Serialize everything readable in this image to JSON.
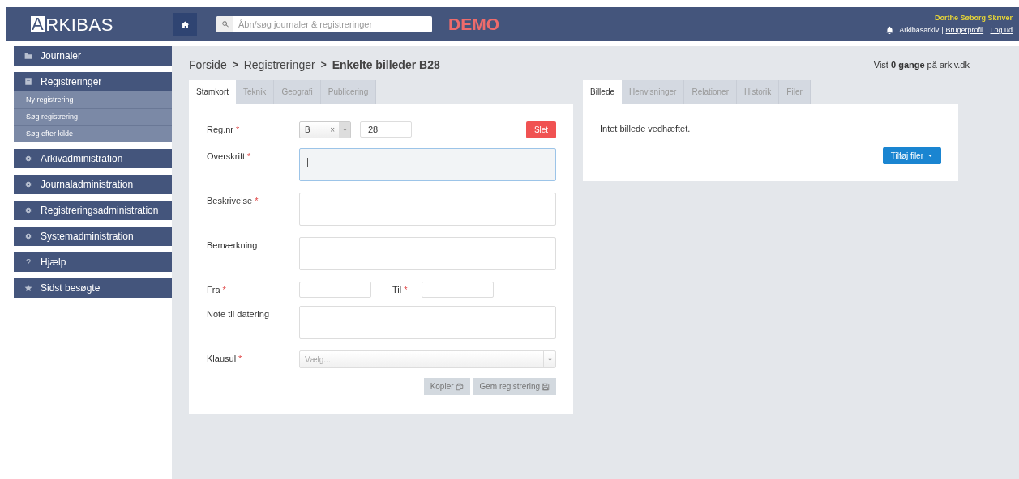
{
  "header": {
    "logo": "ARKIBAS",
    "search": {
      "placeholder": "Åbn/søg journaler & registreringer"
    },
    "badge": "DEMO",
    "user": "Dorthe Søborg Skriver",
    "links": [
      {
        "kind": "text",
        "text": "Arkibasarkiv"
      },
      {
        "kind": "sep",
        "text": "|"
      },
      {
        "kind": "link",
        "text": "Brugerprofil"
      },
      {
        "kind": "sep",
        "text": "|"
      },
      {
        "kind": "link",
        "text": "Log ud"
      }
    ]
  },
  "sidebar": {
    "items": [
      {
        "kind": "folder",
        "label": "Journaler",
        "expanded": false
      },
      {
        "kind": "square",
        "label": "Registreringer",
        "expanded": true,
        "children": [
          {
            "label": "Ny registrering"
          },
          {
            "label": "Søg registrering"
          },
          {
            "label": "Søg efter kilde"
          }
        ]
      },
      {
        "kind": "gear",
        "label": "Arkivadministration",
        "expanded": false
      },
      {
        "kind": "gear",
        "label": "Journaladministration",
        "expanded": false
      },
      {
        "kind": "gear",
        "label": "Registreringsadministration",
        "expanded": false
      },
      {
        "kind": "gear",
        "label": "Systemadministration",
        "expanded": false
      },
      {
        "kind": "char",
        "glyph": "?",
        "label": "Hjælp",
        "expanded": false
      },
      {
        "kind": "star",
        "label": "Sidst besøgte",
        "expanded": false
      }
    ]
  },
  "breadcrumb": [
    {
      "kind": "link",
      "text": "Forside"
    },
    {
      "kind": "sep",
      "text": ">"
    },
    {
      "kind": "link",
      "text": "Registreringer"
    },
    {
      "kind": "sep",
      "text": ">"
    },
    {
      "kind": "current",
      "text": "Enkelte billeder B28"
    }
  ],
  "views": "Vist **0 gange** på arkiv.dk",
  "form": {
    "tabs": [
      {
        "label": "Stamkort",
        "selected": true
      },
      {
        "label": "Teknik",
        "selected": false
      },
      {
        "label": "Geografi",
        "selected": false
      },
      {
        "label": "Publicering",
        "selected": false
      }
    ],
    "fields": [
      {
        "kind": "regnr",
        "label": "Reg.nr",
        "required_mark": "*",
        "series": "B",
        "clear": "×",
        "number": "28",
        "delete_button": "Slet"
      },
      {
        "kind": "textarea",
        "label": "Overskrift",
        "required_mark": "*",
        "focused": true
      },
      {
        "kind": "textarea",
        "label": "Beskrivelse",
        "required_mark": "*",
        "focused": false
      },
      {
        "kind": "textarea",
        "label": "Bemærkning",
        "focused": false
      },
      {
        "kind": "daterange",
        "label": "Fra",
        "required_mark": "*",
        "to_label": "Til",
        "to_required_mark": "*"
      },
      {
        "kind": "textarea",
        "label": "Note til datering",
        "focused": false
      },
      {
        "kind": "dropdown",
        "label": "Klausul",
        "required_mark": "*",
        "placeholder": "Vælg..."
      }
    ],
    "buttons": [
      {
        "kind": "copy",
        "label": "Kopier"
      },
      {
        "kind": "save",
        "label": "Gem registrering"
      }
    ]
  },
  "attachments": {
    "tabs": [
      {
        "label": "Billede",
        "selected": true
      },
      {
        "label": "Henvisninger",
        "selected": false
      },
      {
        "label": "Relationer",
        "selected": false
      },
      {
        "label": "Historik",
        "selected": false
      },
      {
        "label": "Filer",
        "selected": false
      }
    ],
    "message": "Intet billede vedhæftet.",
    "button": "Tilføj filer"
  }
}
